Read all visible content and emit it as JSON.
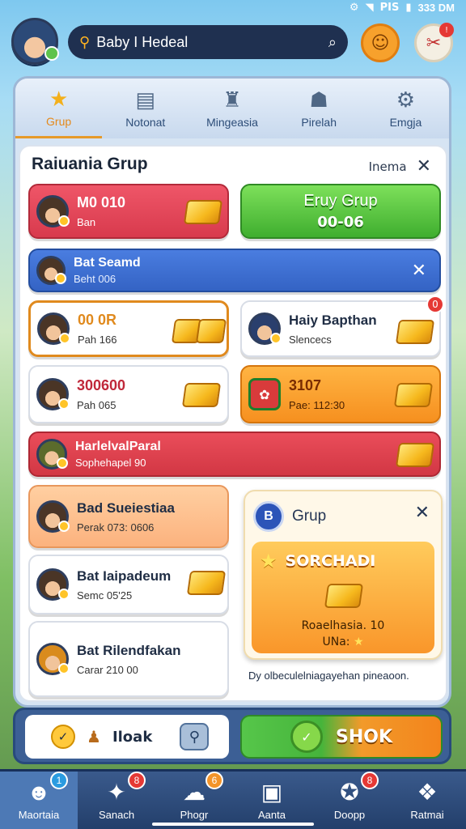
{
  "status": {
    "time": "333 DM",
    "signal": "PIS"
  },
  "topbar": {
    "search_text": "Baby I Hedeal"
  },
  "tabs": [
    {
      "label": "Grup",
      "icon": "★",
      "active": true
    },
    {
      "label": "Notonat",
      "icon": "▤",
      "active": false
    },
    {
      "label": "Mingeasia",
      "icon": "♜",
      "active": false
    },
    {
      "label": "Pirelah",
      "icon": "☗",
      "active": false
    },
    {
      "label": "Emgja",
      "icon": "⚙",
      "active": false
    }
  ],
  "panel": {
    "title": "Raiuania Grup",
    "right_label": "Inema"
  },
  "cards": {
    "red_top": {
      "l1": "M0 010",
      "l2": "Ban"
    },
    "green_btn": {
      "l1": "Eruy Grup",
      "l2": "00-06"
    },
    "blue_row": {
      "l1": "Bat Seamd",
      "l2": "Beht 006"
    },
    "orange_outline": {
      "l1": "00 0R",
      "l2": "Pah 166"
    },
    "happy": {
      "l1": "Haiy Bapthan",
      "l2": "Slencecs",
      "badge": "0"
    },
    "white2": {
      "l1": "300600",
      "l2": "Pah 065"
    },
    "orange2": {
      "l1": "3107",
      "l2": "Pae: 112:30"
    },
    "red_wide": {
      "l1": "HarlelvalParal",
      "l2": "Sophehapel 90"
    },
    "peach": {
      "l1": "Bad Sueiestiaa",
      "l2": "Perak 073: 0606"
    },
    "white3": {
      "l1": "Bat Iaipadeum",
      "l2": "Semc 05'25"
    },
    "white4": {
      "l1": "Bat Rilendfakan",
      "l2": "Carar 210 00"
    }
  },
  "popup": {
    "icon_text": "B",
    "title": "Grup",
    "banner": "SORCHADI",
    "detail1": "Roaelhasia. 10",
    "detail2": "UNa:"
  },
  "footnote": "Dy olbeculelniagayehan pineaoon.",
  "actionbar": {
    "left_label": "Iloak",
    "right_label": "SHOK"
  },
  "nav": [
    {
      "label": "Maortaia",
      "icon": "☻",
      "badge": "1",
      "badge_color": "#2a9be0",
      "active": true
    },
    {
      "label": "Sanach",
      "icon": "✦",
      "badge": "8",
      "badge_color": "#e53935",
      "active": false
    },
    {
      "label": "Phogr",
      "icon": "☁",
      "badge": "6",
      "badge_color": "#f3942a",
      "active": false
    },
    {
      "label": "Aanta",
      "icon": "▣",
      "badge": "",
      "badge_color": "",
      "active": false
    },
    {
      "label": "Doopp",
      "icon": "✪",
      "badge": "8",
      "badge_color": "#e53935",
      "active": false
    },
    {
      "label": "Ratmai",
      "icon": "❖",
      "badge": "",
      "badge_color": "",
      "active": false
    }
  ],
  "colors": {
    "accent_orange": "#f7a12c",
    "green": "#56c64a",
    "red": "#e4404f",
    "blue": "#3c68c8"
  }
}
